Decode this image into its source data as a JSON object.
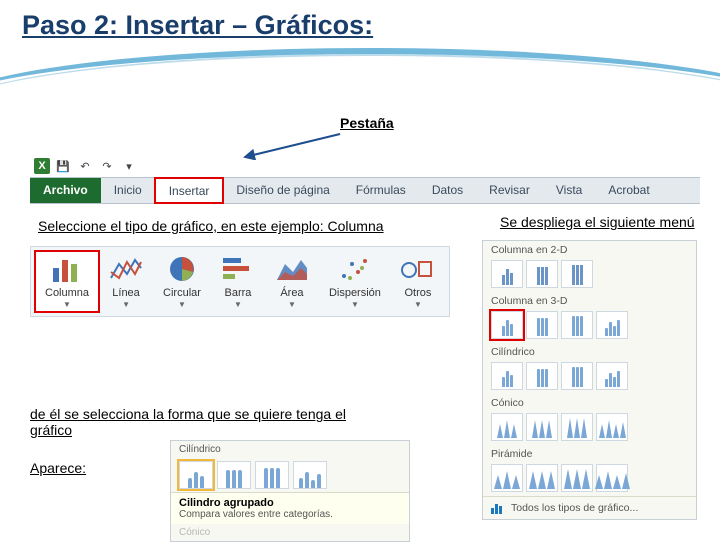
{
  "title": "Paso 2: Insertar – Gráficos:",
  "tab_label": "Pestaña",
  "ribbon_tabs": {
    "file": "Archivo",
    "home": "Inicio",
    "insert": "Insertar",
    "page_layout": "Diseño de página",
    "formulas": "Fórmulas",
    "data": "Datos",
    "review": "Revisar",
    "view": "Vista",
    "acrobat": "Acrobat"
  },
  "instruction_select_type": "Seleccione el tipo de gráfico, en este ejemplo: Columna",
  "instruction_menu_expands": "Se despliega el siguiente menú",
  "chart_types": {
    "column": "Columna",
    "line": "Línea",
    "pie": "Circular",
    "bar": "Barra",
    "area": "Área",
    "scatter": "Dispersión",
    "other": "Otros"
  },
  "instruction_select_shape": "de él se selecciona la forma que se quiere tenga el gráfico",
  "instruction_appears": "Aparece:",
  "tooltip": {
    "category": "Cilíndrico",
    "title": "Cilindro agrupado",
    "description": "Compara valores entre categorías.",
    "next_category": "Cónico"
  },
  "column_menu": {
    "cat_2d": "Columna en 2-D",
    "cat_3d": "Columna en 3-D",
    "cat_cylinder": "Cilíndrico",
    "cat_cone": "Cónico",
    "cat_pyramid": "Pirámide",
    "all_types": "Todos los tipos de gráfico..."
  }
}
